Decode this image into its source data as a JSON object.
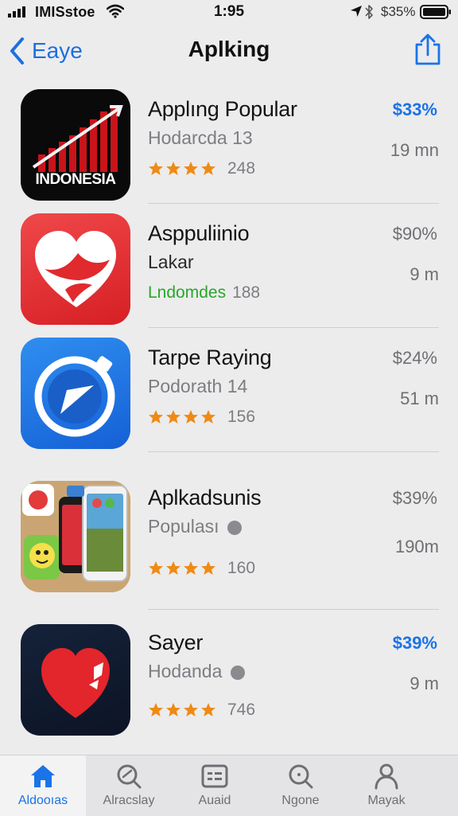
{
  "status_bar": {
    "carrier": "IMISstoe",
    "time": "1:95",
    "battery_text": "$35%"
  },
  "nav": {
    "back_label": "Eaye",
    "title": "Aplking"
  },
  "apps": [
    {
      "name": "Applıng Popular",
      "subtitle": "Hodarcda 13",
      "tag": "",
      "rating": 4,
      "rating_count": "248",
      "price": "$33%",
      "price_highlight": true,
      "size": "19 mn",
      "icon_text": "INDONESIA",
      "icon": "indonesia-chart-icon"
    },
    {
      "name": "Asppuliinio",
      "subtitle": "Lakar",
      "tag": "Lndomdes",
      "rating": 0,
      "rating_count": "188",
      "price": "$90%",
      "price_highlight": false,
      "size": "9 m",
      "icon": "heart-bird-icon"
    },
    {
      "name": "Tarpe Raying",
      "subtitle": "Podorath 14",
      "tag": "",
      "rating": 4,
      "rating_count": "156",
      "price": "$24%",
      "price_highlight": false,
      "size": "51 m",
      "icon": "play-record-icon"
    },
    {
      "name": "Aplkadsunis",
      "subtitle": "Populası",
      "tag": "",
      "rating": 4,
      "rating_count": "160",
      "price": "$39%",
      "price_highlight": false,
      "size": "190m",
      "icon": "phone-collage-icon"
    },
    {
      "name": "Sayer",
      "subtitle": "Hodanda",
      "tag": "",
      "rating": 4,
      "rating_count": "746",
      "price": "$39%",
      "price_highlight": true,
      "size": "9 m",
      "icon": "red-heart-icon"
    }
  ],
  "tabs": [
    {
      "label": "Aldooıas",
      "icon": "home-icon",
      "active": true
    },
    {
      "label": "Alracslay",
      "icon": "search-refresh-icon",
      "active": false
    },
    {
      "label": "Auaid",
      "icon": "list-card-icon",
      "active": false
    },
    {
      "label": "Ngone",
      "icon": "magnifier-icon",
      "active": false
    },
    {
      "label": "Mayak",
      "icon": "person-icon",
      "active": false
    }
  ],
  "colors": {
    "accent": "#1a73e8",
    "star": "#ef8a14",
    "tag_green": "#2aa62a",
    "background": "#ececed"
  }
}
